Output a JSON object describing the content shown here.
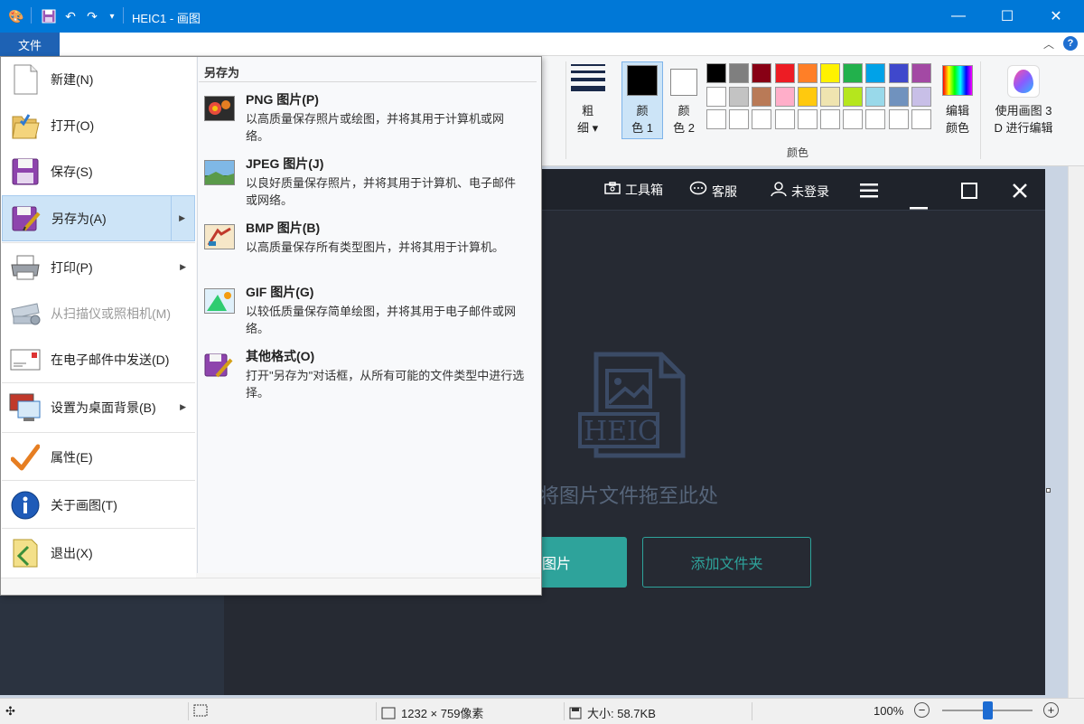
{
  "window": {
    "title": "HEIC1 - 画图",
    "accent": "#0078d7"
  },
  "quick_access": {
    "icons": [
      "paint-app-icon",
      "save-icon",
      "undo-icon",
      "redo-icon",
      "customize-icon"
    ]
  },
  "ribbon": {
    "file_tab": "文件",
    "thickness_label": "粗\n细",
    "thickness_label_top": "粗",
    "thickness_label_bottom": "细",
    "color1_top": "颜",
    "color1_bottom": "色 1",
    "color2_top": "颜",
    "color2_bottom": "色 2",
    "edit_colors_top": "编辑",
    "edit_colors_bottom": "颜色",
    "paint3d_top": "使用画图 3",
    "paint3d_bottom": "D 进行编辑",
    "colors_group_label": "颜色",
    "color1_value": "#000000",
    "color2_value": "#ffffff",
    "palette_row1": [
      "#000000",
      "#7f7f7f",
      "#880015",
      "#ed1c24",
      "#ff7f27",
      "#fff200",
      "#22b14c",
      "#00a2e8",
      "#3f48cc",
      "#a349a4"
    ],
    "palette_row2": [
      "#ffffff",
      "#c3c3c3",
      "#b97a57",
      "#ffaec9",
      "#ffc90e",
      "#efe4b0",
      "#b5e61d",
      "#99d9ea",
      "#7092be",
      "#c8bfe7"
    ],
    "palette_row3": [
      "#ffffff",
      "#ffffff",
      "#ffffff",
      "#ffffff",
      "#ffffff",
      "#ffffff",
      "#ffffff",
      "#ffffff",
      "#ffffff",
      "#ffffff"
    ]
  },
  "file_menu": {
    "items": [
      {
        "label": "新建(N)",
        "icon": "new-file-icon"
      },
      {
        "label": "打开(O)",
        "icon": "open-folder-icon"
      },
      {
        "label": "保存(S)",
        "icon": "save-disk-icon"
      },
      {
        "label": "另存为(A)",
        "icon": "save-as-icon"
      },
      {
        "label": "打印(P)",
        "icon": "printer-icon"
      },
      {
        "label": "从扫描仪或照相机(M)",
        "icon": "scanner-icon"
      },
      {
        "label": "在电子邮件中发送(D)",
        "icon": "email-icon"
      },
      {
        "label": "设置为桌面背景(B)",
        "icon": "desktop-background-icon"
      },
      {
        "label": "属性(E)",
        "icon": "checkmark-icon"
      },
      {
        "label": "关于画图(T)",
        "icon": "info-icon"
      },
      {
        "label": "退出(X)",
        "icon": "exit-icon"
      }
    ],
    "submenu": {
      "header": "另存为",
      "items": [
        {
          "title": "PNG 图片(P)",
          "desc": "以高质量保存照片或绘图，并将其用于计算机或网络。",
          "icon": "png-icon"
        },
        {
          "title": "JPEG 图片(J)",
          "desc": "以良好质量保存照片，并将其用于计算机、电子邮件或网络。",
          "icon": "jpeg-icon"
        },
        {
          "title": "BMP 图片(B)",
          "desc": "以高质量保存所有类型图片，并将其用于计算机。",
          "icon": "bmp-icon"
        },
        {
          "title": "GIF 图片(G)",
          "desc": "以较低质量保存简单绘图，并将其用于电子邮件或网络。",
          "icon": "gif-icon"
        },
        {
          "title": "其他格式(O)",
          "desc": "打开\"另存为\"对话框，从所有可能的文件类型中进行选择。",
          "icon": "other-formats-icon"
        }
      ]
    }
  },
  "canvas_app": {
    "toolbox": "工具箱",
    "service": "客服",
    "login": "未登录",
    "heic_label": "HEIC",
    "drop_text": "将图片文件拖至此处",
    "add_image": "图片",
    "add_folder": "添加文件夹",
    "accent": "#2ea39b"
  },
  "statusbar": {
    "dimensions": "1232 × 759像素",
    "size": "大小: 58.7KB",
    "zoom": "100%",
    "zoom_value": 100
  }
}
